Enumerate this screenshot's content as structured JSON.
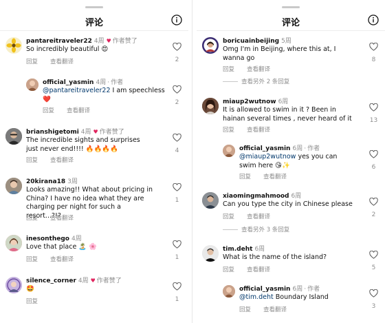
{
  "title": "评论",
  "actions": {
    "reply": "回复",
    "translate": "查看翻译"
  },
  "left": {
    "comments": [
      {
        "user": "pantareitraveler22",
        "time": "4周",
        "liked": "作者赞了",
        "text": "So incredibly beautiful 😍",
        "likes": "2"
      },
      {
        "user": "official_yasmin",
        "time": "4周",
        "role": "作者",
        "mention": "@pantareitraveler22",
        "text": " I am speechless ❤️",
        "likes": "2"
      },
      {
        "user": "brianshigetomi",
        "time": "4周",
        "liked": "作者赞了",
        "text": "The incredible sights and surprises just never end!!!! 🔥🔥🔥🔥",
        "likes": "4"
      },
      {
        "user": "20kirana18",
        "time": "3周",
        "text": "Looks amazing!! What about pricing in China? I have no idea what they are charging per night for such a resort...?!?",
        "likes": "1"
      },
      {
        "user": "inesonthego",
        "time": "4周",
        "text": "Love that place 🏝️ 🌸",
        "likes": "1"
      },
      {
        "user": "silence_corner",
        "time": "4周",
        "liked": "作者赞了",
        "text": "🤩",
        "likes": "1"
      }
    ]
  },
  "right": {
    "comments": [
      {
        "user": "boricuainbeijing",
        "time": "5周",
        "text": "Omg I'm in Beijing,  where this at, I wanna go",
        "likes": "8",
        "more": "查看另外 2 条回复"
      },
      {
        "user": "miaup2wutnow",
        "time": "6周",
        "text": "It is allowed to swim in it ? Been in hainan several times , never heard of it",
        "likes": "13"
      },
      {
        "user": "official_yasmin",
        "time": "6周",
        "role": "作者",
        "mention": "@miaup2wutnow",
        "text": " yes you can swim here 😘✨",
        "likes": "6"
      },
      {
        "user": "xiaomingmahmood",
        "time": "6周",
        "text": "Can you type the city in Chinese please",
        "likes": "2",
        "more": "查看另外 3 条回复"
      },
      {
        "user": "tim.deht",
        "time": "6周",
        "text": "What is the name of the island?",
        "likes": "5"
      },
      {
        "user": "official_yasmin",
        "time": "6周",
        "role": "作者",
        "mention": "@tim.deht",
        "text": " Boundary Island",
        "likes": "3"
      }
    ]
  },
  "colors": {
    "heart": "#e0245e",
    "mention": "#00376b",
    "muted": "#8e8e8e"
  }
}
